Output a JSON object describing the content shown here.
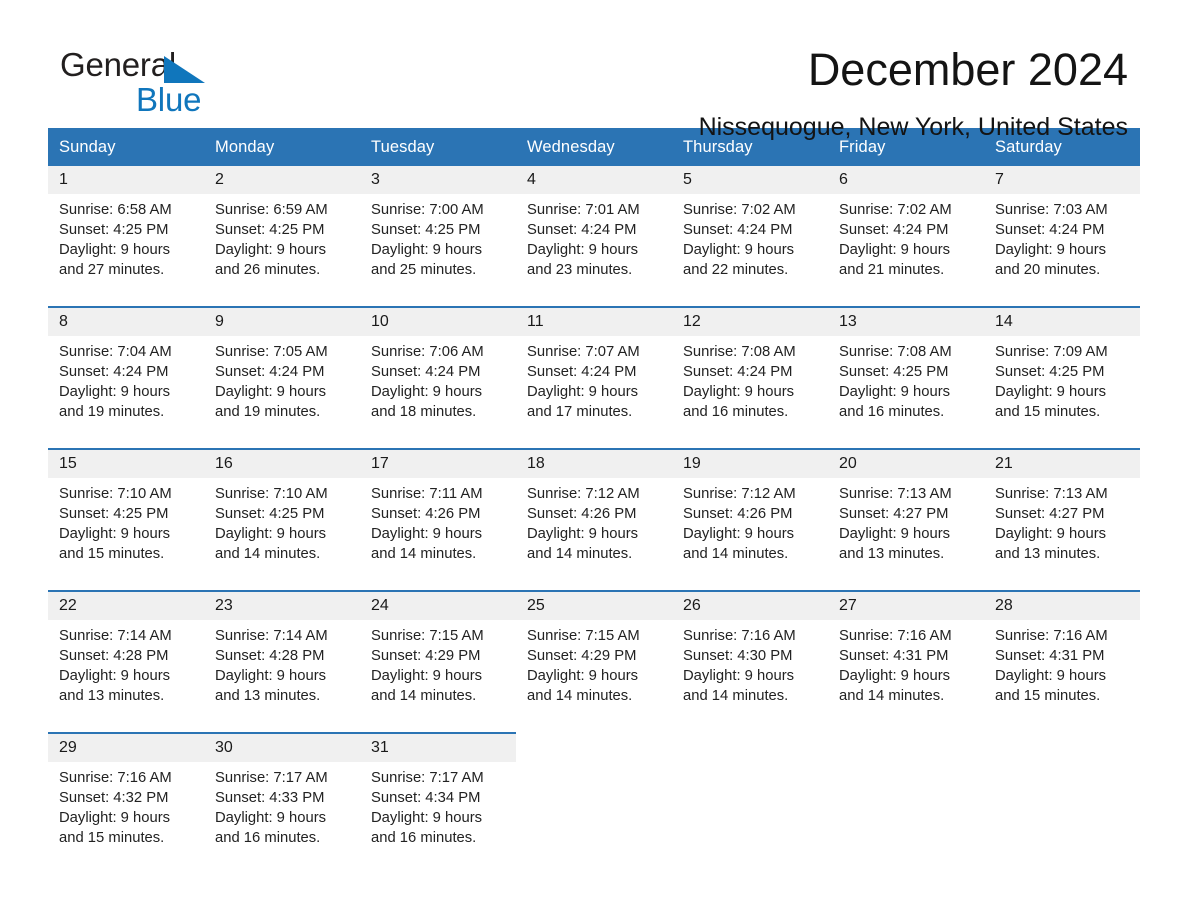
{
  "brand": {
    "line1": "General",
    "line2": "Blue",
    "mark": "triangle-logo",
    "color": "#1076bc"
  },
  "header": {
    "title": "December 2024",
    "subtitle": "Nissequogue, New York, United States"
  },
  "theme": {
    "header_blue": "#2b74b4",
    "daynum_gray": "#f0f0f0",
    "text": "#222222"
  },
  "calendar": {
    "weekday_headers": [
      "Sunday",
      "Monday",
      "Tuesday",
      "Wednesday",
      "Thursday",
      "Friday",
      "Saturday"
    ],
    "weeks": [
      [
        {
          "day": "1",
          "sunrise": "Sunrise: 6:58 AM",
          "sunset": "Sunset: 4:25 PM",
          "daylight1": "Daylight: 9 hours",
          "daylight2": "and 27 minutes."
        },
        {
          "day": "2",
          "sunrise": "Sunrise: 6:59 AM",
          "sunset": "Sunset: 4:25 PM",
          "daylight1": "Daylight: 9 hours",
          "daylight2": "and 26 minutes."
        },
        {
          "day": "3",
          "sunrise": "Sunrise: 7:00 AM",
          "sunset": "Sunset: 4:25 PM",
          "daylight1": "Daylight: 9 hours",
          "daylight2": "and 25 minutes."
        },
        {
          "day": "4",
          "sunrise": "Sunrise: 7:01 AM",
          "sunset": "Sunset: 4:24 PM",
          "daylight1": "Daylight: 9 hours",
          "daylight2": "and 23 minutes."
        },
        {
          "day": "5",
          "sunrise": "Sunrise: 7:02 AM",
          "sunset": "Sunset: 4:24 PM",
          "daylight1": "Daylight: 9 hours",
          "daylight2": "and 22 minutes."
        },
        {
          "day": "6",
          "sunrise": "Sunrise: 7:02 AM",
          "sunset": "Sunset: 4:24 PM",
          "daylight1": "Daylight: 9 hours",
          "daylight2": "and 21 minutes."
        },
        {
          "day": "7",
          "sunrise": "Sunrise: 7:03 AM",
          "sunset": "Sunset: 4:24 PM",
          "daylight1": "Daylight: 9 hours",
          "daylight2": "and 20 minutes."
        }
      ],
      [
        {
          "day": "8",
          "sunrise": "Sunrise: 7:04 AM",
          "sunset": "Sunset: 4:24 PM",
          "daylight1": "Daylight: 9 hours",
          "daylight2": "and 19 minutes."
        },
        {
          "day": "9",
          "sunrise": "Sunrise: 7:05 AM",
          "sunset": "Sunset: 4:24 PM",
          "daylight1": "Daylight: 9 hours",
          "daylight2": "and 19 minutes."
        },
        {
          "day": "10",
          "sunrise": "Sunrise: 7:06 AM",
          "sunset": "Sunset: 4:24 PM",
          "daylight1": "Daylight: 9 hours",
          "daylight2": "and 18 minutes."
        },
        {
          "day": "11",
          "sunrise": "Sunrise: 7:07 AM",
          "sunset": "Sunset: 4:24 PM",
          "daylight1": "Daylight: 9 hours",
          "daylight2": "and 17 minutes."
        },
        {
          "day": "12",
          "sunrise": "Sunrise: 7:08 AM",
          "sunset": "Sunset: 4:24 PM",
          "daylight1": "Daylight: 9 hours",
          "daylight2": "and 16 minutes."
        },
        {
          "day": "13",
          "sunrise": "Sunrise: 7:08 AM",
          "sunset": "Sunset: 4:25 PM",
          "daylight1": "Daylight: 9 hours",
          "daylight2": "and 16 minutes."
        },
        {
          "day": "14",
          "sunrise": "Sunrise: 7:09 AM",
          "sunset": "Sunset: 4:25 PM",
          "daylight1": "Daylight: 9 hours",
          "daylight2": "and 15 minutes."
        }
      ],
      [
        {
          "day": "15",
          "sunrise": "Sunrise: 7:10 AM",
          "sunset": "Sunset: 4:25 PM",
          "daylight1": "Daylight: 9 hours",
          "daylight2": "and 15 minutes."
        },
        {
          "day": "16",
          "sunrise": "Sunrise: 7:10 AM",
          "sunset": "Sunset: 4:25 PM",
          "daylight1": "Daylight: 9 hours",
          "daylight2": "and 14 minutes."
        },
        {
          "day": "17",
          "sunrise": "Sunrise: 7:11 AM",
          "sunset": "Sunset: 4:26 PM",
          "daylight1": "Daylight: 9 hours",
          "daylight2": "and 14 minutes."
        },
        {
          "day": "18",
          "sunrise": "Sunrise: 7:12 AM",
          "sunset": "Sunset: 4:26 PM",
          "daylight1": "Daylight: 9 hours",
          "daylight2": "and 14 minutes."
        },
        {
          "day": "19",
          "sunrise": "Sunrise: 7:12 AM",
          "sunset": "Sunset: 4:26 PM",
          "daylight1": "Daylight: 9 hours",
          "daylight2": "and 14 minutes."
        },
        {
          "day": "20",
          "sunrise": "Sunrise: 7:13 AM",
          "sunset": "Sunset: 4:27 PM",
          "daylight1": "Daylight: 9 hours",
          "daylight2": "and 13 minutes."
        },
        {
          "day": "21",
          "sunrise": "Sunrise: 7:13 AM",
          "sunset": "Sunset: 4:27 PM",
          "daylight1": "Daylight: 9 hours",
          "daylight2": "and 13 minutes."
        }
      ],
      [
        {
          "day": "22",
          "sunrise": "Sunrise: 7:14 AM",
          "sunset": "Sunset: 4:28 PM",
          "daylight1": "Daylight: 9 hours",
          "daylight2": "and 13 minutes."
        },
        {
          "day": "23",
          "sunrise": "Sunrise: 7:14 AM",
          "sunset": "Sunset: 4:28 PM",
          "daylight1": "Daylight: 9 hours",
          "daylight2": "and 13 minutes."
        },
        {
          "day": "24",
          "sunrise": "Sunrise: 7:15 AM",
          "sunset": "Sunset: 4:29 PM",
          "daylight1": "Daylight: 9 hours",
          "daylight2": "and 14 minutes."
        },
        {
          "day": "25",
          "sunrise": "Sunrise: 7:15 AM",
          "sunset": "Sunset: 4:29 PM",
          "daylight1": "Daylight: 9 hours",
          "daylight2": "and 14 minutes."
        },
        {
          "day": "26",
          "sunrise": "Sunrise: 7:16 AM",
          "sunset": "Sunset: 4:30 PM",
          "daylight1": "Daylight: 9 hours",
          "daylight2": "and 14 minutes."
        },
        {
          "day": "27",
          "sunrise": "Sunrise: 7:16 AM",
          "sunset": "Sunset: 4:31 PM",
          "daylight1": "Daylight: 9 hours",
          "daylight2": "and 14 minutes."
        },
        {
          "day": "28",
          "sunrise": "Sunrise: 7:16 AM",
          "sunset": "Sunset: 4:31 PM",
          "daylight1": "Daylight: 9 hours",
          "daylight2": "and 15 minutes."
        }
      ],
      [
        {
          "day": "29",
          "sunrise": "Sunrise: 7:16 AM",
          "sunset": "Sunset: 4:32 PM",
          "daylight1": "Daylight: 9 hours",
          "daylight2": "and 15 minutes."
        },
        {
          "day": "30",
          "sunrise": "Sunrise: 7:17 AM",
          "sunset": "Sunset: 4:33 PM",
          "daylight1": "Daylight: 9 hours",
          "daylight2": "and 16 minutes."
        },
        {
          "day": "31",
          "sunrise": "Sunrise: 7:17 AM",
          "sunset": "Sunset: 4:34 PM",
          "daylight1": "Daylight: 9 hours",
          "daylight2": "and 16 minutes."
        },
        {
          "day": "",
          "sunrise": "",
          "sunset": "",
          "daylight1": "",
          "daylight2": ""
        },
        {
          "day": "",
          "sunrise": "",
          "sunset": "",
          "daylight1": "",
          "daylight2": ""
        },
        {
          "day": "",
          "sunrise": "",
          "sunset": "",
          "daylight1": "",
          "daylight2": ""
        },
        {
          "day": "",
          "sunrise": "",
          "sunset": "",
          "daylight1": "",
          "daylight2": ""
        }
      ]
    ]
  }
}
